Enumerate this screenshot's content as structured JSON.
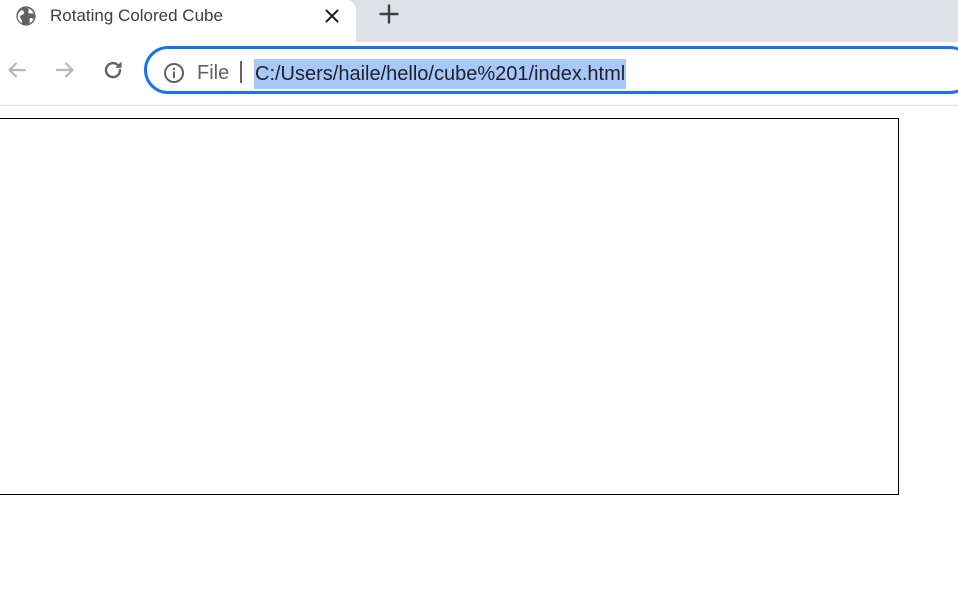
{
  "tab": {
    "title": "Rotating Colored Cube",
    "favicon": "globe-icon",
    "close_icon": "close-icon"
  },
  "tabstrip": {
    "new_tab_icon": "plus-icon"
  },
  "toolbar": {
    "back_icon": "back-arrow-icon",
    "forward_icon": "forward-arrow-icon",
    "reload_icon": "reload-icon"
  },
  "omnibox": {
    "site_info_icon": "info-icon",
    "scheme_label": "File",
    "url": "C:/Users/haile/hello/cube%201/index.html"
  },
  "colors": {
    "tabstrip_bg": "#dee1e6",
    "focus_ring": "#1a73e8",
    "selection": "#a8c7fa",
    "text": "#202124"
  }
}
